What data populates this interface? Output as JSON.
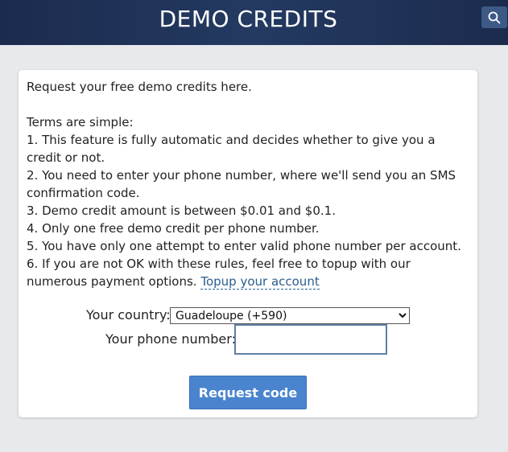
{
  "header": {
    "title": "DEMO CREDITS",
    "search_icon": "search-icon"
  },
  "intro": "Request your free demo credits here.",
  "terms": {
    "heading": "Terms are simple:",
    "items": [
      "1. This feature is fully automatic and decides whether to give you a credit or not.",
      "2. You need to enter your phone number, where we'll send you an SMS confirmation code.",
      "3. Demo credit amount is between $0.01 and $0.1.",
      "4. Only one free demo credit per phone number.",
      "5. You have only one attempt to enter valid phone number per account.",
      "6. If you are not OK with these rules, feel free to topup with our numerous payment options."
    ],
    "topup_link": "Topup your account"
  },
  "form": {
    "country_label": "Your country:",
    "country_selected": "Guadeloupe (+590)",
    "phone_label": "Your phone number:",
    "phone_value": "",
    "submit_label": "Request code"
  },
  "colors": {
    "header_bg": "#1b2b4d",
    "button_bg": "#4a84cf",
    "link": "#2a5d8e",
    "page_bg": "#e8e9ec"
  }
}
